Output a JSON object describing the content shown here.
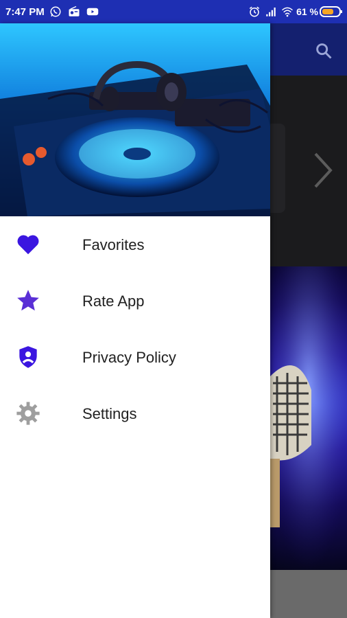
{
  "status_bar": {
    "time": "7:47 PM",
    "battery_percent": "61 %",
    "icons": [
      "whatsapp-icon",
      "radio-icon",
      "youtube-icon",
      "alarm-icon",
      "signal-icon",
      "wifi-icon",
      "battery-icon"
    ]
  },
  "app_bar": {
    "search_icon": "search-icon"
  },
  "drawer": {
    "header_image": "dj-mixer-headphones-image",
    "items": [
      {
        "label": "Favorites",
        "icon": "heart-icon"
      },
      {
        "label": "Rate App",
        "icon": "star-icon"
      },
      {
        "label": "Privacy Policy",
        "icon": "shield-user-icon"
      },
      {
        "label": "Settings",
        "icon": "gear-icon"
      }
    ]
  },
  "colors": {
    "status_bar": "#1e2fb3",
    "app_bar": "#14206f",
    "accent_purple": "#3b16e0",
    "settings_gray": "#9e9e9e",
    "menu_text": "#212121"
  }
}
